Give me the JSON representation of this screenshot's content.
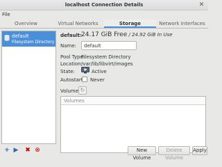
{
  "window": {
    "title": "localhost Connection Details"
  },
  "menu": {
    "file": "File"
  },
  "tabs": [
    {
      "label": "Overview",
      "active": false
    },
    {
      "label": "Virtual Networks",
      "active": false
    },
    {
      "label": "Storage",
      "active": true
    },
    {
      "label": "Network Interfaces",
      "active": false
    }
  ],
  "sidebar": {
    "pool": {
      "name": "default",
      "type": "Filesystem Directory"
    }
  },
  "details": {
    "pool_name": "default:",
    "free": "24.17 GiB Free",
    "separator": " / ",
    "in_use": "24.92 GiB In Use",
    "name_label": "Name:",
    "name_value": "default",
    "pool_type_label": "Pool Type:",
    "pool_type_value": "Filesystem Directory",
    "location_label": "Location:",
    "location_value": "/var/lib/libvirt/images",
    "state_label": "State:",
    "state_value": "Active",
    "autostart_label": "Autostart:",
    "autostart_value": "Never",
    "volumes_label": "Volumes",
    "volumes_column": "Volumes"
  },
  "buttons": {
    "new_volume": "New Volume",
    "delete_volume": "Delete Volume",
    "apply": "Apply"
  },
  "colors": {
    "selection": "#4a90d9",
    "delete_red": "#cc0000",
    "add_blue": "#3465a4"
  }
}
